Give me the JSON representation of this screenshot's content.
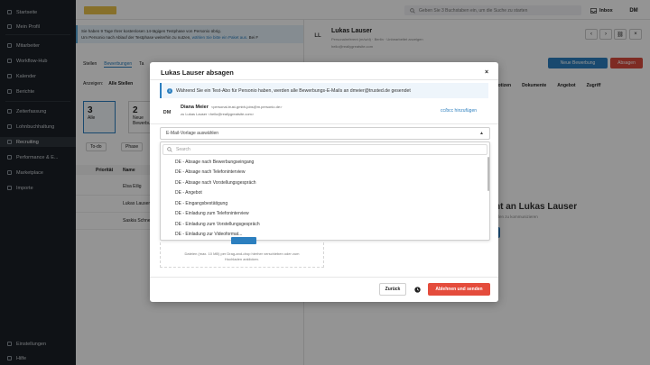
{
  "sidebar": {
    "items": [
      {
        "label": "Startseite",
        "icon": "home-icon"
      },
      {
        "label": "Mein Profil",
        "icon": "user-icon"
      },
      {
        "label": "Mitarbeiter",
        "icon": "people-icon"
      },
      {
        "label": "Workflow-Hub",
        "icon": "workflow-icon"
      },
      {
        "label": "Kalender",
        "icon": "calendar-icon"
      },
      {
        "label": "Berichte",
        "icon": "chart-icon"
      },
      {
        "label": "Zeiterfassung",
        "icon": "clock-icon"
      },
      {
        "label": "Lohnbuchhaltung",
        "icon": "payroll-icon"
      },
      {
        "label": "Recruiting",
        "icon": "recruiting-icon"
      },
      {
        "label": "Performance & E...",
        "icon": "performance-icon"
      },
      {
        "label": "Marketplace",
        "icon": "marketplace-icon"
      },
      {
        "label": "Importe",
        "icon": "import-icon"
      }
    ],
    "footer": [
      {
        "label": "Einstellungen",
        "icon": "gear-icon"
      },
      {
        "label": "Hilfe",
        "icon": "help-icon"
      }
    ],
    "active_index": 8
  },
  "topbar": {
    "search_placeholder": "Geben Sie 3 Buchstaben ein, um die Suche zu starten",
    "inbox_label": "Inbox",
    "user_initials": "DM"
  },
  "banner": {
    "line1": "Sie haben 9 Tage Ihrer kostenlosen 14-tägigen Testphase von Personio übrig.",
    "line2": "Um Personio nach Ablauf der Testphase weiterhin zu nutzen,",
    "link": "wählen Sie bitte ein Paket aus.",
    "tail": "Bei F"
  },
  "left": {
    "tabs": [
      "Stellen",
      "Bewerbungen",
      "Ta"
    ],
    "filter_label": "Anzeigen:",
    "filter_value": "Alle Stellen",
    "stats": [
      {
        "num": "3",
        "label": "Alle"
      },
      {
        "num": "2",
        "label": "Neue Bewerbung"
      }
    ],
    "chips": [
      "To-do",
      "Phase"
    ],
    "columns": [
      "Priorität",
      "Name"
    ],
    "rows": [
      "Elsa Eilig",
      "Lukas Lauser",
      "Saskia Schnell"
    ]
  },
  "candidate": {
    "initials": "LL",
    "name": "Lukas Lauser",
    "subtitle": "Personalreferent (m/w/d) · Berlin · Unbearbeitet anzeigen",
    "email": "hello@reallygreatsite.com",
    "move_button": "Neue Bewerbung",
    "reject_button": "Absagen",
    "tabs": [
      "Notizen",
      "Dokumente",
      "Angebot",
      "Zugriff"
    ],
    "heading": "ht an Lukas Lauser",
    "sub": "nden zu kommunizieren"
  },
  "modal": {
    "title": "Lukas Lauser absagen",
    "close_label": "×",
    "info_text": "Während Sie ein Test-Abo für Personio haben, werden alle Bewerbungs-E-Mails an dmeier@trusted.de gesendet",
    "sender": {
      "initials": "DM",
      "name": "Diana Meier",
      "email": "<personal-trust-gmbh-jobs@m.personio.de>",
      "to": "zu Lukas Lauser <hello@reallygreatsite.com>"
    },
    "cc_link": "cc/bcc hinzufügen",
    "template_select": "E-Mail-Vorlage auswählen",
    "dropdown_search_placeholder": "Search",
    "options": [
      "DE - Absage nach Bewerbungseingang",
      "DE - Absage nach Telefoninterview",
      "DE - Absage nach Vorstellungsgespräch",
      "DE - Angebot",
      "DE - Eingangsbestätigung",
      "DE - Einladung zum Telefoninterview",
      "DE - Einladung zum Vorstellungsgespräch",
      "DE - Einladung zur Videoformat..."
    ],
    "upload_text_1": "Dateien (max. 10 MB) per Drag-and-drop hierher verschieben oder zum",
    "upload_text_2": "Hochladen anklicken.",
    "back_button": "Zurück",
    "send_button": "Ablehnen und senden"
  }
}
